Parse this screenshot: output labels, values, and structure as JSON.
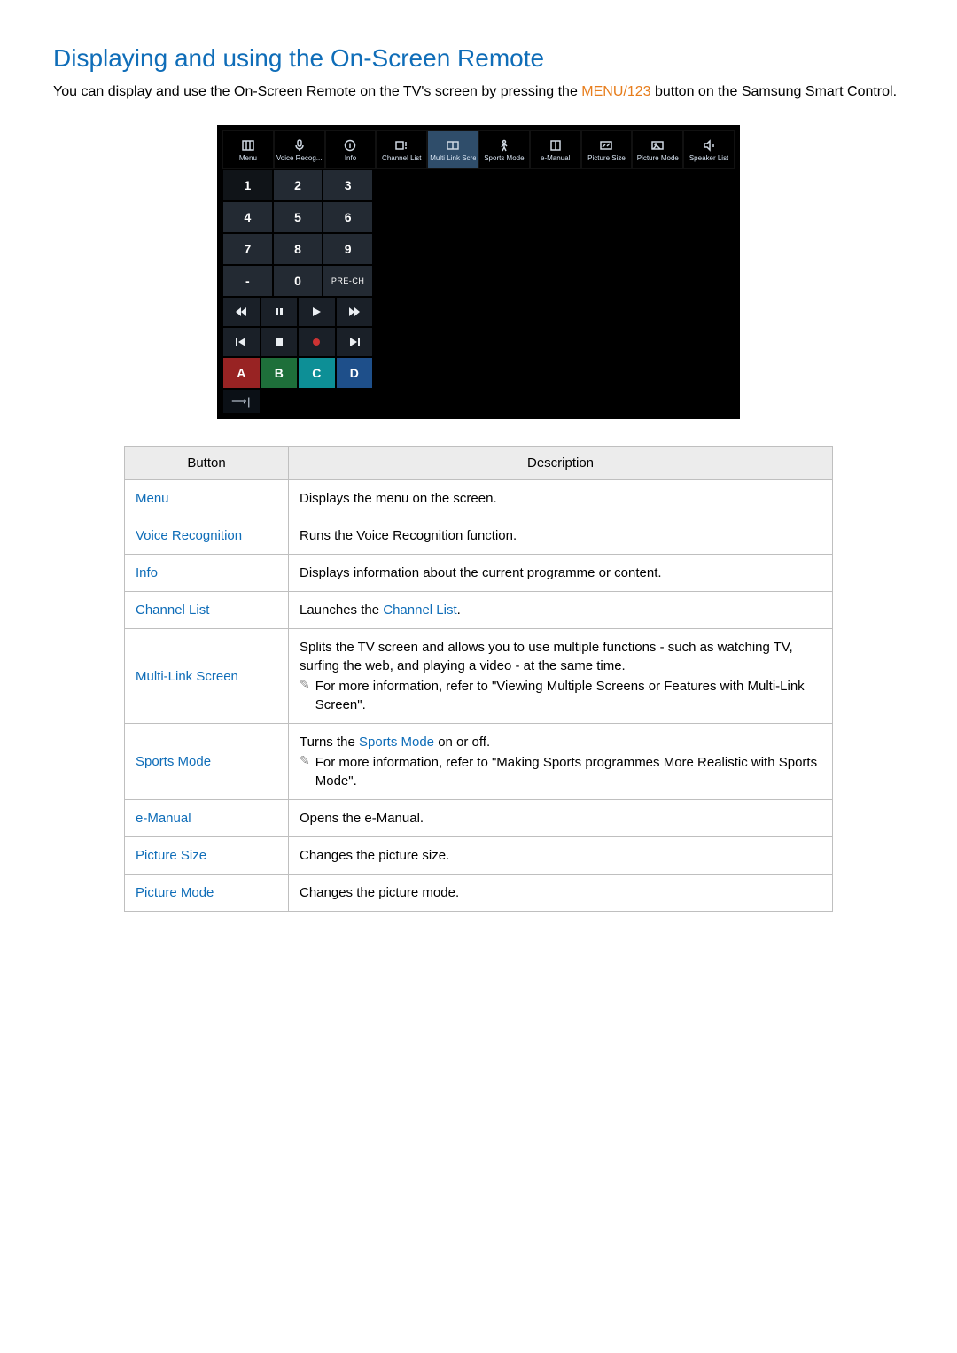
{
  "heading": "Displaying and using the On-Screen Remote",
  "intro_part1": "You can display and use the On-Screen Remote on the TV's screen by pressing the ",
  "intro_orange": "MENU/123",
  "intro_part2": " button on the Samsung Smart Control.",
  "top_icons": [
    {
      "label": "Menu"
    },
    {
      "label": "Voice Recog..."
    },
    {
      "label": "Info"
    },
    {
      "label": "Channel List"
    },
    {
      "label": "Multi Link Screen"
    },
    {
      "label": "Sports Mode"
    },
    {
      "label": "e-Manual"
    },
    {
      "label": "Picture Size"
    },
    {
      "label": "Picture Mode"
    },
    {
      "label": "Speaker List"
    }
  ],
  "numpad": [
    [
      "1",
      "2",
      "3"
    ],
    [
      "4",
      "5",
      "6"
    ],
    [
      "7",
      "8",
      "9"
    ],
    [
      "-",
      "0",
      "PRE-CH"
    ]
  ],
  "abcd": [
    "A",
    "B",
    "C",
    "D"
  ],
  "footer_arrow": "⟶|",
  "table": {
    "headers": [
      "Button",
      "Description"
    ],
    "rows": [
      {
        "button": "Menu",
        "desc": "Displays the menu on the screen."
      },
      {
        "button": "Voice Recognition",
        "desc": "Runs the Voice Recognition function."
      },
      {
        "button": "Info",
        "desc": "Displays information about the current programme or content."
      },
      {
        "button": "Channel List",
        "desc_pre": "Launches the ",
        "link": "Channel List",
        "desc_post": "."
      },
      {
        "button": "Multi-Link Screen",
        "desc": "Splits the TV screen and allows you to use multiple functions - such as watching TV, surfing the web, and playing a video - at the same time.",
        "note": "For more information, refer to \"Viewing Multiple Screens or Features with Multi-Link Screen\"."
      },
      {
        "button": "Sports Mode",
        "desc_pre": "Turns the ",
        "link": "Sports Mode",
        "desc_post": " on or off.",
        "note": "For more information, refer to \"Making Sports programmes More Realistic with Sports Mode\"."
      },
      {
        "button": "e-Manual",
        "desc": "Opens the e-Manual."
      },
      {
        "button": "Picture Size",
        "desc": "Changes the picture size."
      },
      {
        "button": "Picture Mode",
        "desc": "Changes the picture mode."
      }
    ]
  }
}
